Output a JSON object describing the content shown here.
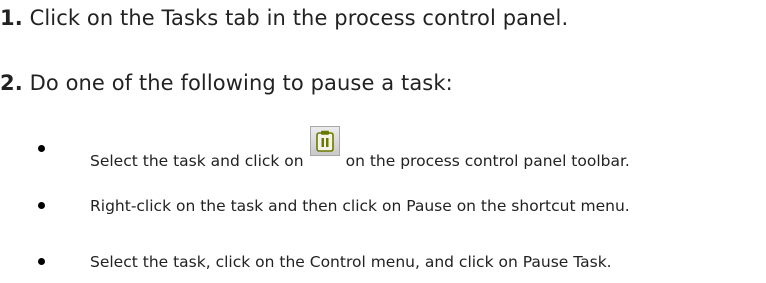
{
  "steps": [
    {
      "number": "1.",
      "text": " Click on the Tasks tab in the process control panel."
    },
    {
      "number": "2.",
      "text": " Do one of the following to pause a task:"
    }
  ],
  "bullets": [
    {
      "before_icon": "Select the task and click on",
      "icon": "pause-task-icon",
      "after_icon": "on the process control panel toolbar."
    },
    {
      "text": "Right-click on the task and then click on Pause on the shortcut menu."
    },
    {
      "text": "Select the task, click on the Control menu, and click on Pause Task."
    }
  ],
  "colors": {
    "text": "#222222",
    "icon_frame": "#c9c9c9",
    "icon_accent": "#6a7a00"
  }
}
